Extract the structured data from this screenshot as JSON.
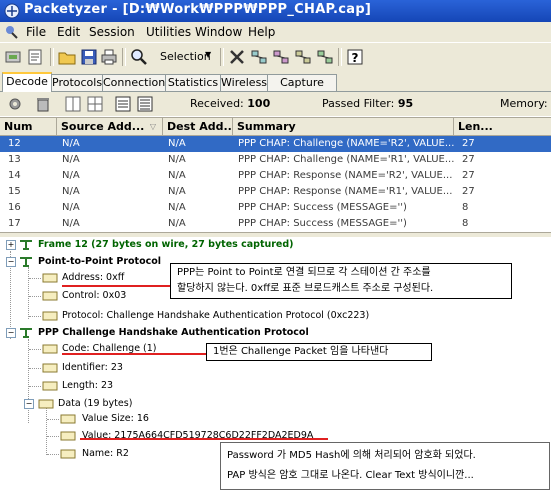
{
  "window": {
    "title": "Packetyzer - [D:₩Work₩PPP₩PPP_CHAP.cap]"
  },
  "menu": {
    "items": [
      "File",
      "Edit",
      "Session",
      "Utilities",
      "Window",
      "Help"
    ]
  },
  "toolbar": {
    "selection_label": "Selection"
  },
  "tabs": [
    "Decode",
    "Protocols",
    "Connections",
    "Statistics",
    "Wireless",
    "Capture Filter"
  ],
  "status": {
    "received_label": "Received:",
    "received_value": "100",
    "passed_label": "Passed Filter:",
    "passed_value": "95",
    "memory_label": "Memory:"
  },
  "packet_list": {
    "columns": [
      "Num",
      "Source Add...",
      "Dest Add...",
      "Summary",
      "Len..."
    ],
    "rows": [
      [
        "12",
        "N/A",
        "N/A",
        "PPP CHAP: Challenge (NAME='R2', VALUE...",
        "27"
      ],
      [
        "13",
        "N/A",
        "N/A",
        "PPP CHAP: Challenge (NAME='R1', VALUE...",
        "27"
      ],
      [
        "14",
        "N/A",
        "N/A",
        "PPP CHAP: Response (NAME='R2', VALUE...",
        "27"
      ],
      [
        "15",
        "N/A",
        "N/A",
        "PPP CHAP: Response (NAME='R1', VALUE...",
        "27"
      ],
      [
        "16",
        "N/A",
        "N/A",
        "PPP CHAP: Success (MESSAGE='')",
        "8"
      ],
      [
        "17",
        "N/A",
        "N/A",
        "PPP CHAP: Success (MESSAGE='')",
        "8"
      ]
    ],
    "selected_index": 0
  },
  "tree": {
    "frame": "Frame 12 (27 bytes on wire, 27 bytes captured)",
    "ppp": "Point-to-Point Protocol",
    "address": "Address: 0xff",
    "control": "Control: 0x03",
    "protocol": "Protocol: Challenge Handshake Authentication Protocol (0xc223)",
    "chap": "PPP Challenge Handshake Authentication Protocol",
    "code": "Code: Challenge (1)",
    "identifier": "Identifier: 23",
    "length": "Length: 23",
    "data": "Data (19 bytes)",
    "value_size": "Value Size: 16",
    "value": "Value: 2175A664CFD519728C6D22FF2DA2ED9A",
    "name": "Name: R2"
  },
  "callouts": {
    "address_line1": "PPP는 Point to Point로 연결 되므로 각 스테이션 간 주소를",
    "address_line2": "할당하지 않는다. 0xff로 표준 브로드캐스트 주소로 구성된다.",
    "code": "1번은 Challenge Packet 임을 나타낸다",
    "value_line1": "Password 가 MD5 Hash에 의해 처리되어 암호화 되었다.",
    "value_line2": "PAP 방식은 암호 그대로 나온다. Clear Text 방식이니깐..."
  },
  "colors": {
    "title_bar": "#2a63d8",
    "selection": "#316ac5",
    "tree_bold_green": "#006400",
    "annotation_red": "#e02020"
  }
}
